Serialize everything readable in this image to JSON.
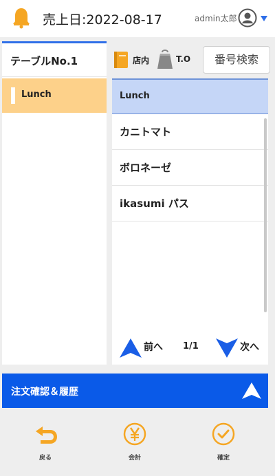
{
  "header": {
    "sale_date": "売上日:2022-08-17",
    "user_name": "admin太郎"
  },
  "left_panel": {
    "table_tab_label": "テーブルNo.1",
    "categories": [
      {
        "label": "Lunch",
        "selected": true
      }
    ]
  },
  "right_panel": {
    "tennai_label": "店内",
    "takeout_label": "T.O",
    "search_button_label": "番号検索",
    "category_header": "Lunch",
    "menu_items": [
      "カニトマト",
      "ボロネーゼ",
      "ikasumi パス"
    ]
  },
  "pager": {
    "prev_label": "前へ",
    "page_indicator": "1/1",
    "next_label": "次へ"
  },
  "order_bar": {
    "label": "注文確認＆履歴"
  },
  "footer": {
    "back_label": "戻る",
    "checkout_label": "会計",
    "confirm_label": "確定"
  },
  "colors": {
    "accent_orange": "#f5a623",
    "primary_blue": "#0a5ae8",
    "selected_category_bg": "#fdd18a",
    "selected_header_bg": "#c5d6f7"
  },
  "icons": [
    "bell-icon",
    "user-avatar-icon",
    "caret-down-icon",
    "tennai-icon",
    "takeout-bag-icon",
    "prev-arrow-icon",
    "next-arrow-icon",
    "chevron-up-icon",
    "back-icon",
    "yen-icon",
    "check-icon"
  ]
}
